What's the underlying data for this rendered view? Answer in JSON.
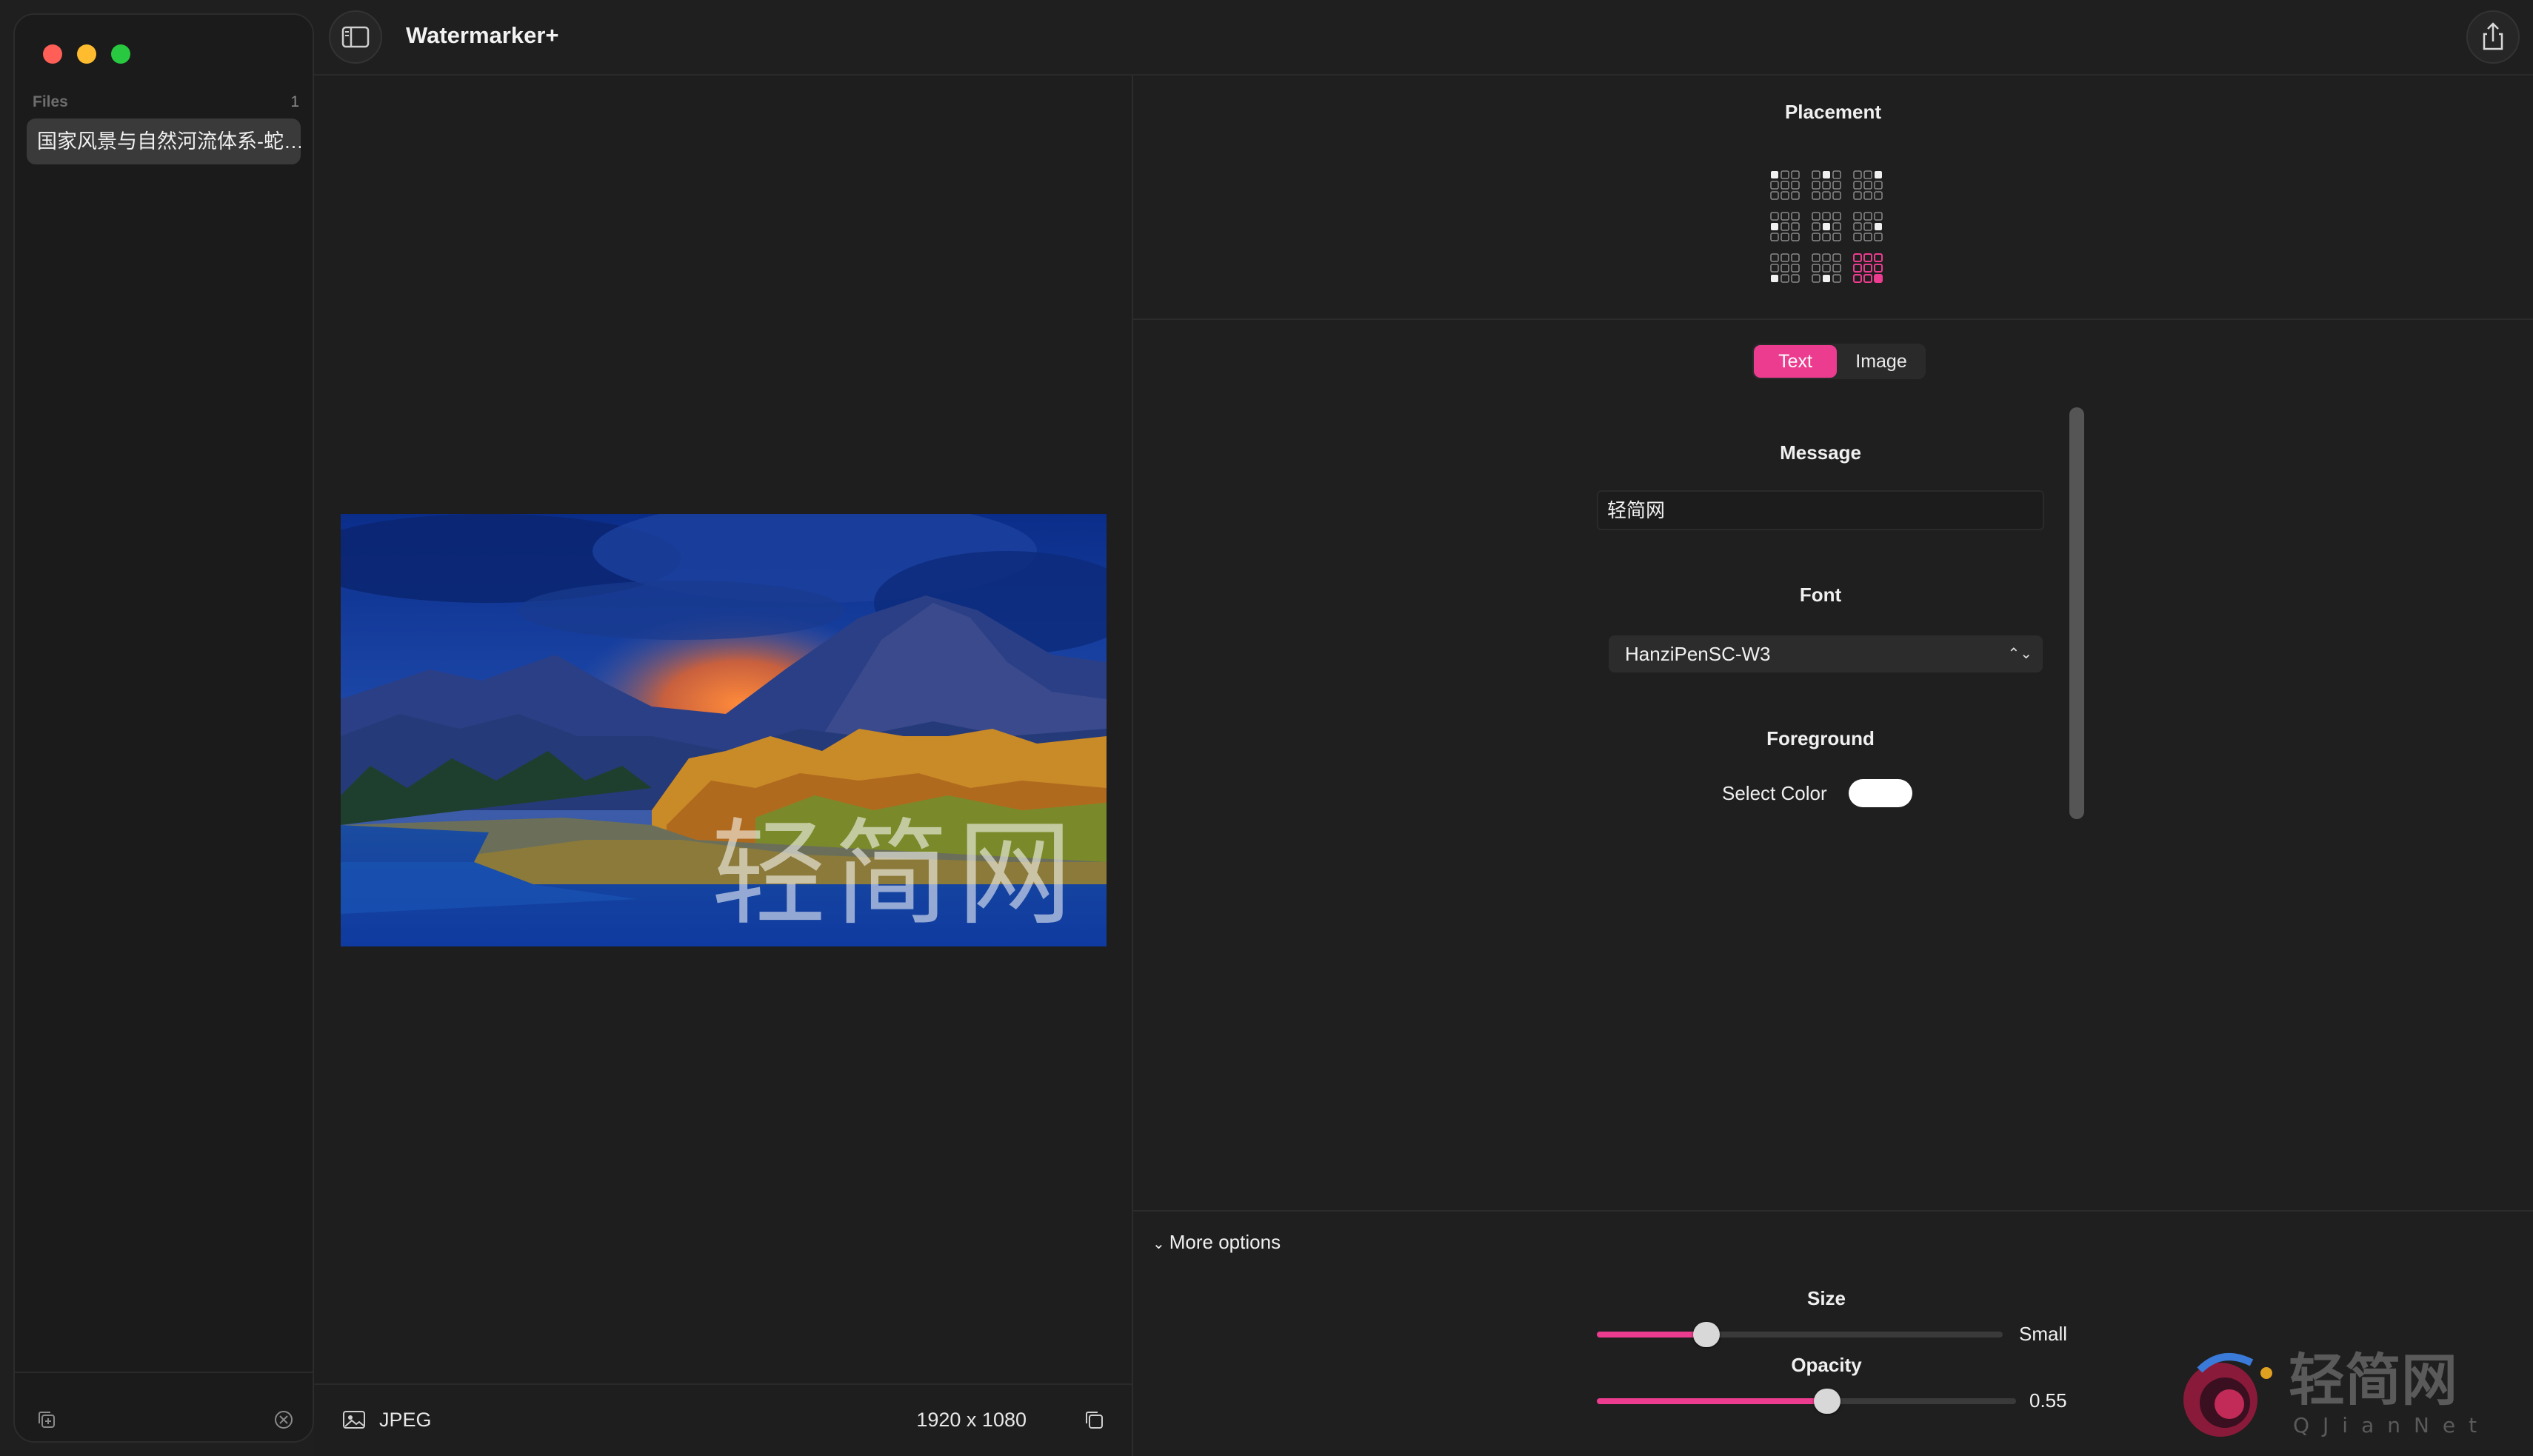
{
  "window": {
    "app_title": "Watermarker+"
  },
  "sidebar": {
    "files_header": "Files",
    "files_count": "1",
    "items": [
      {
        "label": "国家风景与自然河流体系-蛇…"
      }
    ]
  },
  "preview": {
    "format": "JPEG",
    "dimensions": "1920 x 1080",
    "watermark_text": "轻简网"
  },
  "settings": {
    "placement_title": "Placement",
    "placement_grid_selected": "bottom-right",
    "tabs": [
      {
        "label": "Text",
        "active": true
      },
      {
        "label": "Image",
        "active": false
      }
    ],
    "message_title": "Message",
    "message_value": "轻简网",
    "font_title": "Font",
    "font_value": "HanziPenSC-W3",
    "foreground_title": "Foreground",
    "select_color_label": "Select Color",
    "foreground_color": "#ffffff",
    "more_options_label": "More options",
    "size_title": "Size",
    "size_value": "Small",
    "size_fraction": 0.27,
    "opacity_title": "Opacity",
    "opacity_value": "0.55"
  },
  "colors": {
    "accent": "#ec3c8f",
    "background": "#1e1e1e"
  },
  "logo": {
    "text": "轻简网",
    "sub": "QJianNet"
  }
}
